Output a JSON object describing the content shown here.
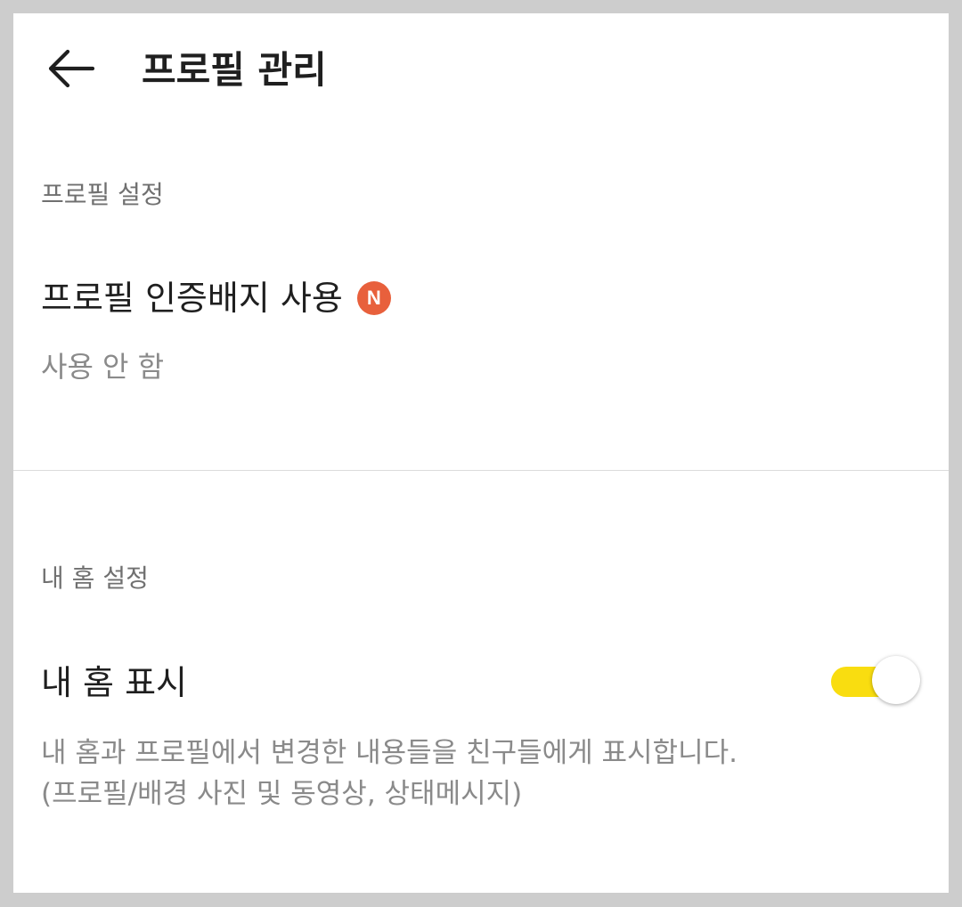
{
  "header": {
    "title": "프로필 관리",
    "back_icon": "arrow-left-icon"
  },
  "profile_section": {
    "label": "프로필 설정",
    "badge_item": {
      "title": "프로필 인증배지 사용",
      "badge_text": "N",
      "badge_color": "#e8603c",
      "value": "사용 안 함"
    }
  },
  "home_section": {
    "label": "내 홈 설정",
    "show_home": {
      "title": "내 홈 표시",
      "enabled": true,
      "toggle_color": "#f9dd10",
      "description_line1": "내 홈과 프로필에서 변경한 내용들을 친구들에게 표시합니다.",
      "description_line2": "(프로필/배경 사진 및 동영상, 상태메시지)"
    }
  },
  "colors": {
    "background_outer": "#cdcdcd",
    "panel": "#ffffff",
    "title_text": "#1f1f1f",
    "secondary_text": "#8a8a8a"
  }
}
